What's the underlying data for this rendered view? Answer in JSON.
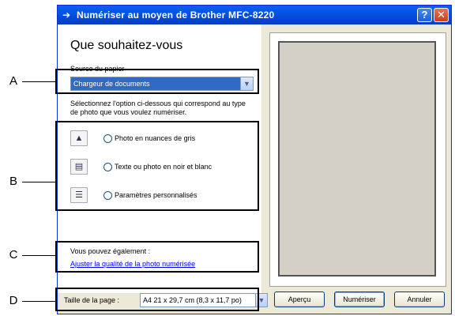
{
  "window": {
    "title": "Numériser au moyen de Brother MFC-8220",
    "help_label": "?",
    "close_label": "✕"
  },
  "left": {
    "heading": "Que souhaitez-vous",
    "source_label": "Source du papier",
    "source_value": "Chargeur de documents",
    "instruction": "Sélectionnez l'option ci-dessous qui correspond au type de photo que vous voulez numériser.",
    "options": [
      {
        "label": "Photo en nuances de gris",
        "icon": "grayscale-photo-icon"
      },
      {
        "label": "Texte ou photo en noir et blanc",
        "icon": "bw-text-icon"
      },
      {
        "label": "Paramètres personnalisés",
        "icon": "custom-settings-icon"
      }
    ],
    "also_label": "Vous pouvez également :",
    "link_label": "Ajuster la qualité de la photo numérisée"
  },
  "bottom": {
    "page_size_label": "Taille de la page :",
    "page_size_value": "A4 21 x 29,7 cm (8,3 x 11,7 po)",
    "preview_label": "Aperçu",
    "scan_label": "Numériser",
    "cancel_label": "Annuler"
  },
  "annotations": [
    "A",
    "B",
    "C",
    "D"
  ]
}
